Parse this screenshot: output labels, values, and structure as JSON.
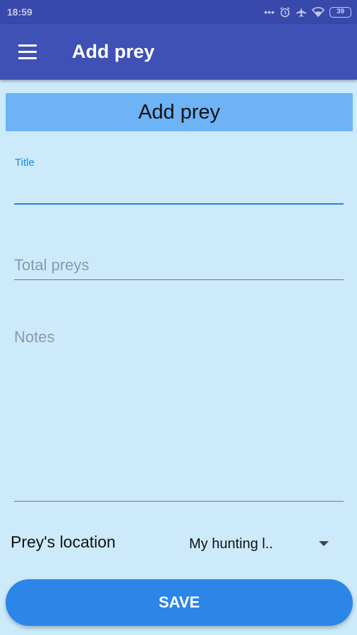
{
  "status": {
    "time": "18:59",
    "battery": "39",
    "icons": [
      "more-dots-icon",
      "alarm-icon",
      "airplane-icon",
      "wifi-icon",
      "battery-icon"
    ]
  },
  "appbar": {
    "title": "Add prey"
  },
  "form": {
    "heading": "Add prey",
    "title_label": "Title",
    "title_value": "",
    "total_preys_placeholder": "Total preys",
    "notes_placeholder": "Notes",
    "location_label": "Prey's location",
    "location_value": "My hunting l..",
    "save_label": "SAVE"
  },
  "colors": {
    "status_bar": "#3949ab",
    "app_bar": "#3f51b5",
    "banner": "#6db3f5",
    "background": "#cdeafb",
    "accent": "#2b86e8"
  }
}
